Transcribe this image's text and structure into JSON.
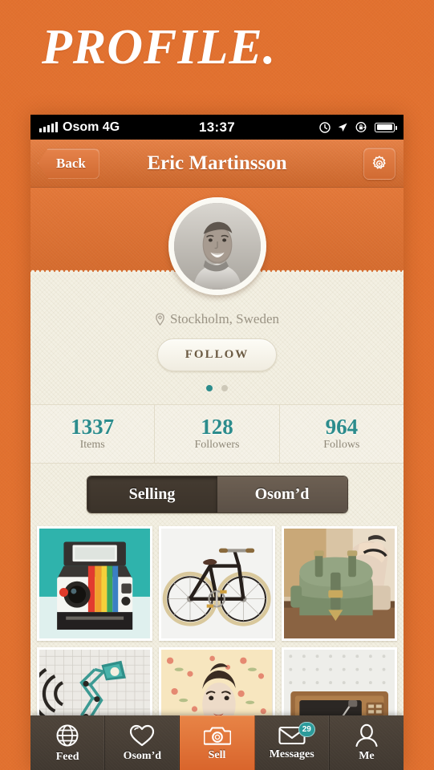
{
  "poster": {
    "title": "PROFILE."
  },
  "colors": {
    "orange": "#e2712f",
    "cream": "#f3f0e3",
    "teal": "#2c8c8c",
    "brown": "#4e443a"
  },
  "statusbar": {
    "carrier": "Osom 4G",
    "time": "13:37",
    "icons": [
      "clock-icon",
      "location-arrow-icon",
      "rotation-lock-icon",
      "battery-icon"
    ]
  },
  "navbar": {
    "back_label": "Back",
    "title": "Eric Martinsson",
    "settings_icon": "gear-icon"
  },
  "profile": {
    "avatar_alt": "Eric Martinsson",
    "location_icon": "map-pin-icon",
    "location": "Stockholm, Sweden",
    "follow_label": "FOLLOW",
    "page_dots": {
      "count": 2,
      "active_index": 0
    }
  },
  "stats": [
    {
      "value": "1337",
      "label": "Items"
    },
    {
      "value": "128",
      "label": "Followers"
    },
    {
      "value": "964",
      "label": "Follows"
    }
  ],
  "segmented": {
    "options": [
      {
        "label": "Selling",
        "active": true
      },
      {
        "label": "Osom’d",
        "active": false
      }
    ]
  },
  "grid": {
    "items": [
      {
        "name": "polaroid-camera",
        "bg": "#2fb3ac"
      },
      {
        "name": "vintage-bicycle",
        "bg": "#f2f2f0"
      },
      {
        "name": "green-satchel-bag",
        "bg": "#cbb79a"
      },
      {
        "name": "teal-desk-lamp",
        "bg": "#e6e6e2"
      },
      {
        "name": "woman-floral-wallpaper",
        "bg": "#f6e3bd"
      },
      {
        "name": "vintage-record-player",
        "bg": "#e9e9e6"
      }
    ]
  },
  "tabbar": {
    "tabs": [
      {
        "label": "Feed",
        "icon": "globe-icon",
        "active": false,
        "badge": ""
      },
      {
        "label": "Osom’d",
        "icon": "heart-icon",
        "active": false,
        "badge": ""
      },
      {
        "label": "Sell",
        "icon": "camera-icon",
        "active": true,
        "badge": ""
      },
      {
        "label": "Messages",
        "icon": "envelope-icon",
        "active": false,
        "badge": "29"
      },
      {
        "label": "Me",
        "icon": "person-icon",
        "active": false,
        "badge": ""
      }
    ]
  }
}
